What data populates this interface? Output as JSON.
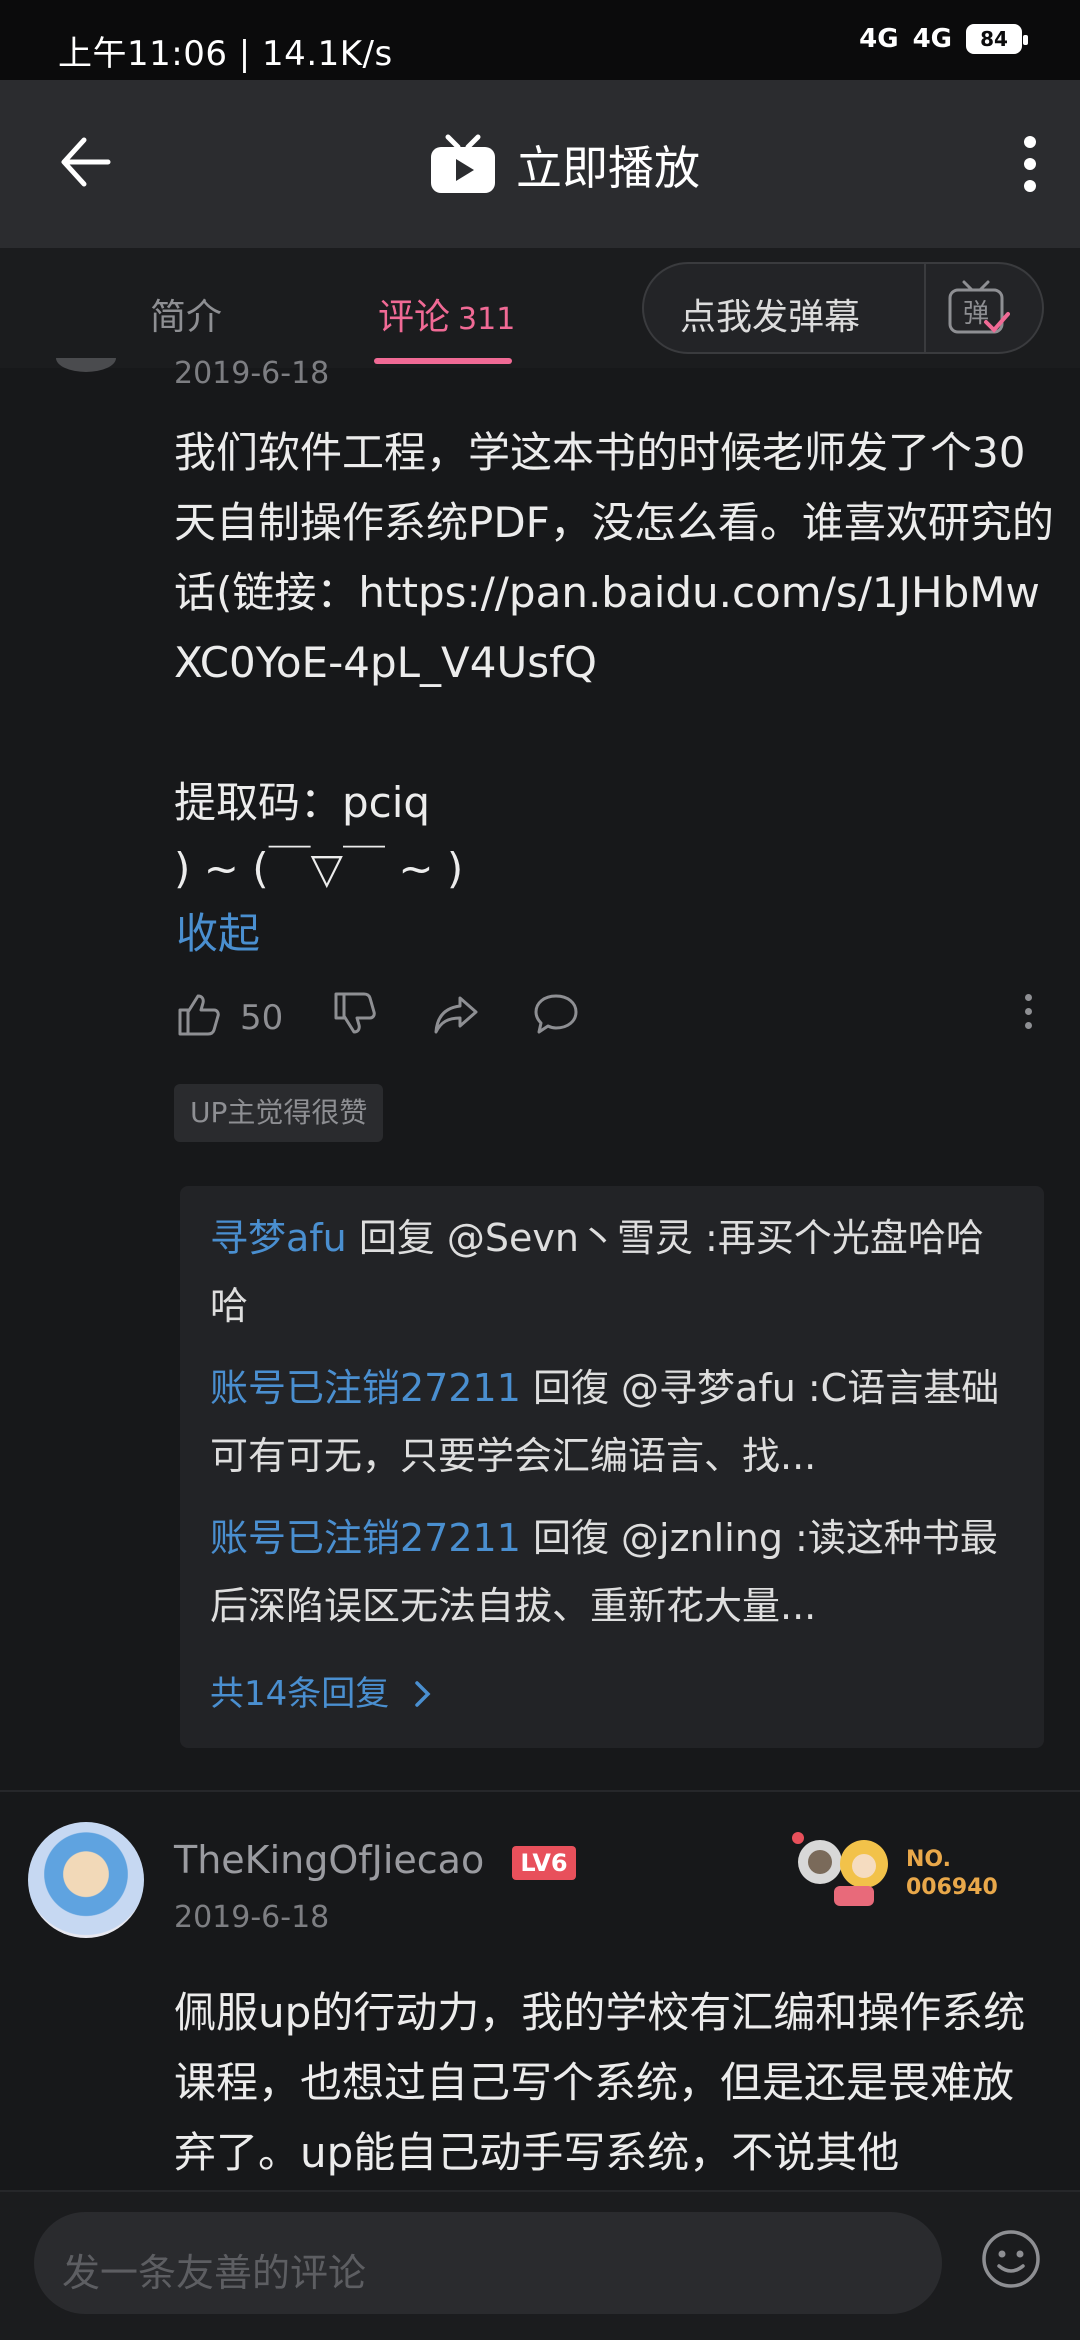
{
  "status": {
    "time_speed": "上午11:06 | 14.1K/s",
    "network1": "4G",
    "network2": "4G",
    "battery": "84"
  },
  "header": {
    "title": "立即播放"
  },
  "tabs": {
    "intro": "简介",
    "comments": "评论",
    "comments_count": "311",
    "danmu_button": "点我发弹幕",
    "danmu_icon_char": "弹"
  },
  "comment1": {
    "date": "2019-6-18",
    "text": "我们软件工程，学这本书的时候老师发了个30天自制操作系统PDF，没怎么看。谁喜欢研究的话(链接：https://pan.baidu.com/s/1JHbMwXC0YoE-4pL_V4UsfQ",
    "code_line": "提取码：pciq",
    "emoticon": ") ~ (￣▽￣ ~ )",
    "collapse": "收起",
    "likes": "50",
    "up_badge": "UP主觉得很赞",
    "replies": [
      {
        "user": "寻梦afu",
        "text": " 回复 @Sevn丶雪灵 :再买个光盘哈哈哈"
      },
      {
        "user": "账号已注销27211",
        "text": " 回復 @寻梦afu :C语言基础可有可无，只要学会汇编语言、找..."
      },
      {
        "user": "账号已注销27211",
        "text": " 回復 @jznling :读这种书最后深陷误区无法自拔、重新花大量..."
      }
    ],
    "all_replies": "共14条回复"
  },
  "comment2": {
    "user": "TheKingOfJiecao",
    "level": "LV6",
    "date": "2019-6-18",
    "no_label": "NO.",
    "no_number": "006940",
    "text": "佩服up的行动力，我的学校有汇编和操作系统课程，也想过自己写个系统，但是还是畏难放弃了。up能自己动手写系统，不说其他"
  },
  "input": {
    "placeholder": "发一条友善的评论"
  }
}
